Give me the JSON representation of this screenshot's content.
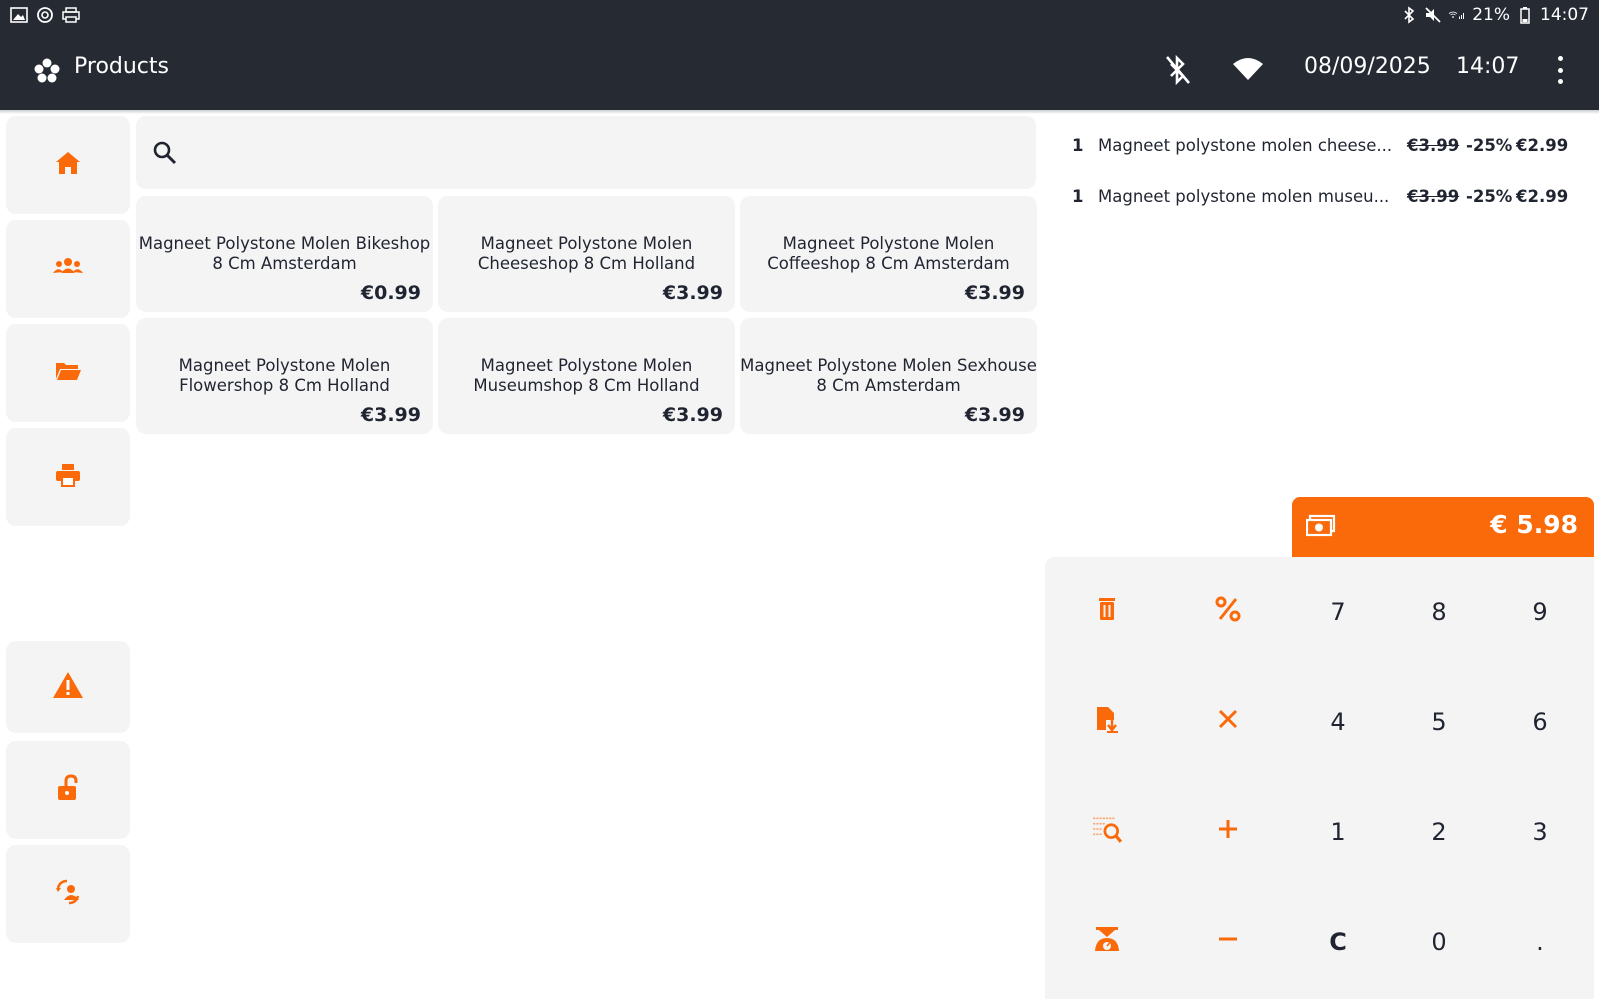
{
  "statusbar": {
    "battery": "21%",
    "time": "14:07"
  },
  "appbar": {
    "title": "Products",
    "date": "08/09/2025",
    "time": "14:07"
  },
  "sidebar": {
    "items": [
      {
        "name": "home",
        "icon": "home-icon"
      },
      {
        "name": "customers",
        "icon": "users-icon"
      },
      {
        "name": "folders",
        "icon": "folder-open-icon"
      },
      {
        "name": "print",
        "icon": "printer-icon"
      },
      {
        "name": "warning",
        "icon": "warning-icon"
      },
      {
        "name": "unlock",
        "icon": "unlock-icon"
      },
      {
        "name": "switch-user",
        "icon": "user-switch-icon"
      }
    ]
  },
  "search": {
    "placeholder": ""
  },
  "products": [
    {
      "name": "Magneet Polystone Molen Bikeshop 8 Cm Amsterdam",
      "price": "€0.99"
    },
    {
      "name": "Magneet Polystone Molen Cheeseshop 8 Cm Holland",
      "price": "€3.99"
    },
    {
      "name": "Magneet Polystone Molen Coffeeshop 8 Cm Amsterdam",
      "price": "€3.99"
    },
    {
      "name": "Magneet Polystone Molen Flowershop 8 Cm Holland",
      "price": "€3.99"
    },
    {
      "name": "Magneet Polystone Molen Museumshop 8 Cm Holland",
      "price": "€3.99"
    },
    {
      "name": "Magneet Polystone Molen Sexhouse 8 Cm Amsterdam",
      "price": "€3.99"
    }
  ],
  "order": {
    "lines": [
      {
        "qty": "1",
        "desc": "Magneet polystone molen cheese...",
        "old_price": "€3.99",
        "discount": "-25%",
        "price": "€2.99"
      },
      {
        "qty": "1",
        "desc": "Magneet polystone molen museu...",
        "old_price": "€3.99",
        "discount": "-25%",
        "price": "€2.99"
      }
    ],
    "total": "€ 5.98"
  },
  "keypad": {
    "digits": [
      "7",
      "8",
      "9",
      "4",
      "5",
      "6",
      "1",
      "2",
      "3",
      "C",
      "0",
      "."
    ],
    "actions": [
      "trash-icon",
      "percent-icon",
      "times-icon",
      "file-download-icon",
      "plus-icon",
      "list-search-icon",
      "minus-icon",
      "scale-icon"
    ]
  },
  "colors": {
    "accent": "#fa6a0a",
    "bar": "#252a33",
    "tile": "#f4f4f5",
    "text": "#1f2430"
  }
}
